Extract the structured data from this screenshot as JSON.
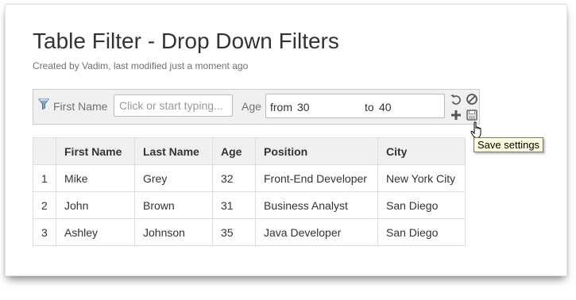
{
  "page": {
    "title": "Table Filter - Drop Down Filters",
    "byline": "Created by Vadim, last modified just a moment ago"
  },
  "filter": {
    "first_name_label": "First Name",
    "first_name_placeholder": "Click or start typing...",
    "age_label": "Age",
    "age_from_label": "from",
    "age_from_value": "30",
    "age_to_label": "to",
    "age_to_value": "40",
    "icons": [
      "funnel-icon",
      "undo-icon",
      "clear-icon",
      "add-icon",
      "save-icon"
    ]
  },
  "tooltip": {
    "text": "Save settings"
  },
  "table": {
    "headers": [
      "",
      "First Name",
      "Last Name",
      "Age",
      "Position",
      "City"
    ],
    "rows": [
      [
        "1",
        "Mike",
        "Grey",
        "32",
        "Front-End Developer",
        "New York City"
      ],
      [
        "2",
        "John",
        "Brown",
        "31",
        "Business Analyst",
        "San Diego"
      ],
      [
        "3",
        "Ashley",
        "Johnson",
        "35",
        "Java Developer",
        "San Diego"
      ]
    ]
  },
  "colors": {
    "text": "#333333",
    "muted": "#707070",
    "header_bg": "#f0f0f0",
    "border": "#dddddd",
    "tooltip_bg": "#ffffe1"
  }
}
